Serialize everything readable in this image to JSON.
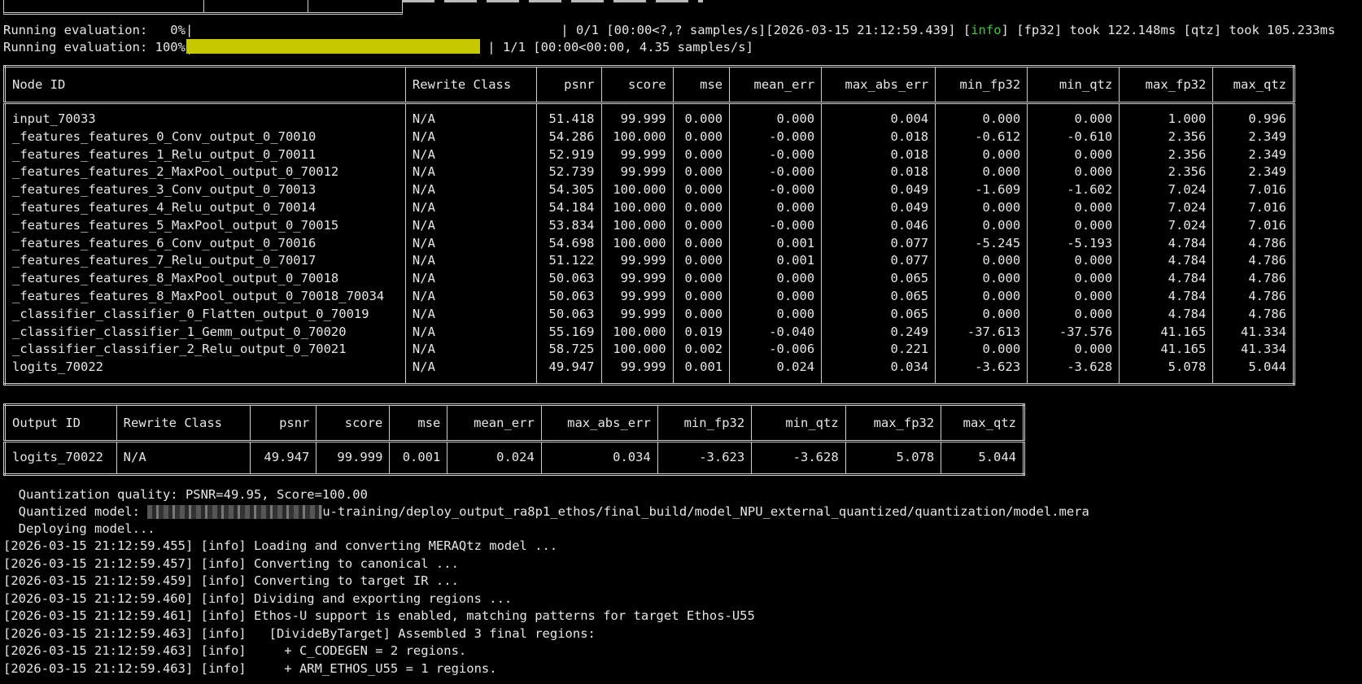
{
  "progress": [
    {
      "prefix": "Running evaluation:   0%|",
      "percent": 0,
      "suffix": "| 0/1 [00:00<?,? samples/s][2026-03-15 21:12:59.439] [",
      "info_word": "info",
      "suffix2": "] [fp32] took 122.148ms [qtz] took 105.233ms"
    },
    {
      "prefix": "Running evaluation: 100%|",
      "percent": 100,
      "suffix": "| 1/1 [00:00<00:00, 4.35 samples/s]"
    }
  ],
  "node_table": {
    "headers": [
      "Node ID",
      "Rewrite Class",
      "psnr",
      "score",
      "mse",
      "mean_err",
      "max_abs_err",
      "min_fp32",
      "min_qtz",
      "max_fp32",
      "max_qtz"
    ],
    "rows": [
      [
        "input_70033",
        "N/A",
        "51.418",
        "99.999",
        "0.000",
        "0.000",
        "0.004",
        "0.000",
        "0.000",
        "1.000",
        "0.996"
      ],
      [
        "_features_features_0_Conv_output_0_70010",
        "N/A",
        "54.286",
        "100.000",
        "0.000",
        "-0.000",
        "0.018",
        "-0.612",
        "-0.610",
        "2.356",
        "2.349"
      ],
      [
        "_features_features_1_Relu_output_0_70011",
        "N/A",
        "52.919",
        "99.999",
        "0.000",
        "-0.000",
        "0.018",
        "0.000",
        "0.000",
        "2.356",
        "2.349"
      ],
      [
        "_features_features_2_MaxPool_output_0_70012",
        "N/A",
        "52.739",
        "99.999",
        "0.000",
        "-0.000",
        "0.018",
        "0.000",
        "0.000",
        "2.356",
        "2.349"
      ],
      [
        "_features_features_3_Conv_output_0_70013",
        "N/A",
        "54.305",
        "100.000",
        "0.000",
        "-0.000",
        "0.049",
        "-1.609",
        "-1.602",
        "7.024",
        "7.016"
      ],
      [
        "_features_features_4_Relu_output_0_70014",
        "N/A",
        "54.184",
        "100.000",
        "0.000",
        "0.000",
        "0.049",
        "0.000",
        "0.000",
        "7.024",
        "7.016"
      ],
      [
        "_features_features_5_MaxPool_output_0_70015",
        "N/A",
        "53.834",
        "100.000",
        "0.000",
        "-0.000",
        "0.046",
        "0.000",
        "0.000",
        "7.024",
        "7.016"
      ],
      [
        "_features_features_6_Conv_output_0_70016",
        "N/A",
        "54.698",
        "100.000",
        "0.000",
        "0.001",
        "0.077",
        "-5.245",
        "-5.193",
        "4.784",
        "4.786"
      ],
      [
        "_features_features_7_Relu_output_0_70017",
        "N/A",
        "51.122",
        "99.999",
        "0.000",
        "0.001",
        "0.077",
        "0.000",
        "0.000",
        "4.784",
        "4.786"
      ],
      [
        "_features_features_8_MaxPool_output_0_70018",
        "N/A",
        "50.063",
        "99.999",
        "0.000",
        "0.000",
        "0.065",
        "0.000",
        "0.000",
        "4.784",
        "4.786"
      ],
      [
        "_features_features_8_MaxPool_output_0_70018_70034",
        "N/A",
        "50.063",
        "99.999",
        "0.000",
        "0.000",
        "0.065",
        "0.000",
        "0.000",
        "4.784",
        "4.786"
      ],
      [
        "_classifier_classifier_0_Flatten_output_0_70019",
        "N/A",
        "50.063",
        "99.999",
        "0.000",
        "0.000",
        "0.065",
        "0.000",
        "0.000",
        "4.784",
        "4.786"
      ],
      [
        "_classifier_classifier_1_Gemm_output_0_70020",
        "N/A",
        "55.169",
        "100.000",
        "0.019",
        "-0.040",
        "0.249",
        "-37.613",
        "-37.576",
        "41.165",
        "41.334"
      ],
      [
        "_classifier_classifier_2_Relu_output_0_70021",
        "N/A",
        "58.725",
        "100.000",
        "0.002",
        "-0.006",
        "0.221",
        "0.000",
        "0.000",
        "41.165",
        "41.334"
      ],
      [
        "logits_70022",
        "N/A",
        "49.947",
        "99.999",
        "0.001",
        "0.024",
        "0.034",
        "-3.623",
        "-3.628",
        "5.078",
        "5.044"
      ]
    ]
  },
  "output_table": {
    "headers": [
      "Output ID",
      "Rewrite Class",
      "psnr",
      "score",
      "mse",
      "mean_err",
      "max_abs_err",
      "min_fp32",
      "min_qtz",
      "max_fp32",
      "max_qtz"
    ],
    "rows": [
      [
        "logits_70022",
        "N/A",
        "49.947",
        "99.999",
        "0.001",
        "0.024",
        "0.034",
        "-3.623",
        "-3.628",
        "5.078",
        "5.044"
      ]
    ]
  },
  "summary": {
    "quality": "  Quantization quality: PSNR=49.95, Score=100.00",
    "model_prefix": "  Quantized model: ",
    "model_path": "u-training/deploy_output_ra8p1_ethos/final_build/model_NPU_external_quantized/quantization/model.mera",
    "deploying": "  Deploying model..."
  },
  "log": [
    "[2026-03-15 21:12:59.455] [info] Loading and converting MERAQtz model ...",
    "[2026-03-15 21:12:59.457] [info] Converting to canonical ...",
    "[2026-03-15 21:12:59.459] [info] Converting to target IR ...",
    "[2026-03-15 21:12:59.460] [info] Dividing and exporting regions ...",
    "[2026-03-15 21:12:59.461] [info] Ethos-U support is enabled, matching patterns for target Ethos-U55",
    "[2026-03-15 21:12:59.463] [info]   [DivideByTarget] Assembled 3 final regions:",
    "[2026-03-15 21:12:59.463] [info]     + C_CODEGEN = 2 regions.",
    "[2026-03-15 21:12:59.463] [info]     + ARM_ETHOS_U55 = 1 regions."
  ],
  "colors": {
    "background": "#000000",
    "text": "#e6e6e6",
    "progress_fill": "#c8c800",
    "info_green": "#3cc83c"
  }
}
